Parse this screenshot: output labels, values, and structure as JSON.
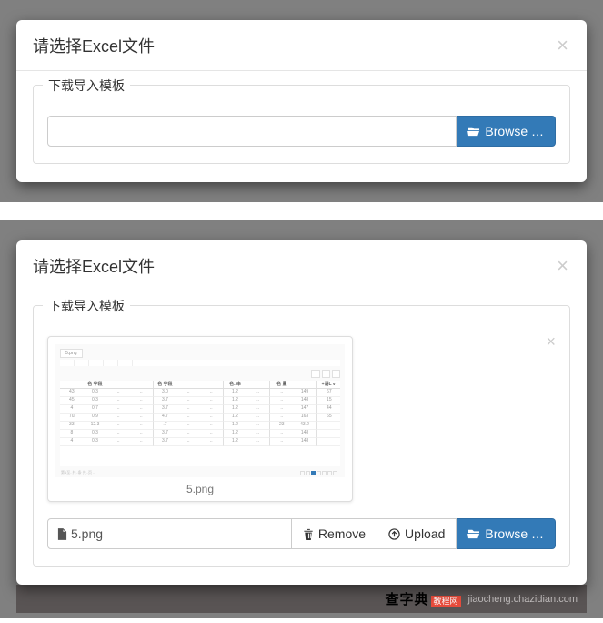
{
  "modal1": {
    "title": "请选择Excel文件",
    "legend": "下载导入模板",
    "file_name": "",
    "browse_label": "Browse …"
  },
  "modal2": {
    "title": "请选择Excel文件",
    "legend": "下载导入模板",
    "preview_caption": "5.png",
    "file_name": "5.png",
    "remove_label": "Remove",
    "upload_label": "Upload",
    "browse_label": "Browse …"
  },
  "footer": {
    "logo_main": "查字典",
    "logo_sub": "教程网",
    "url": "jiaocheng.chazidian.com"
  }
}
